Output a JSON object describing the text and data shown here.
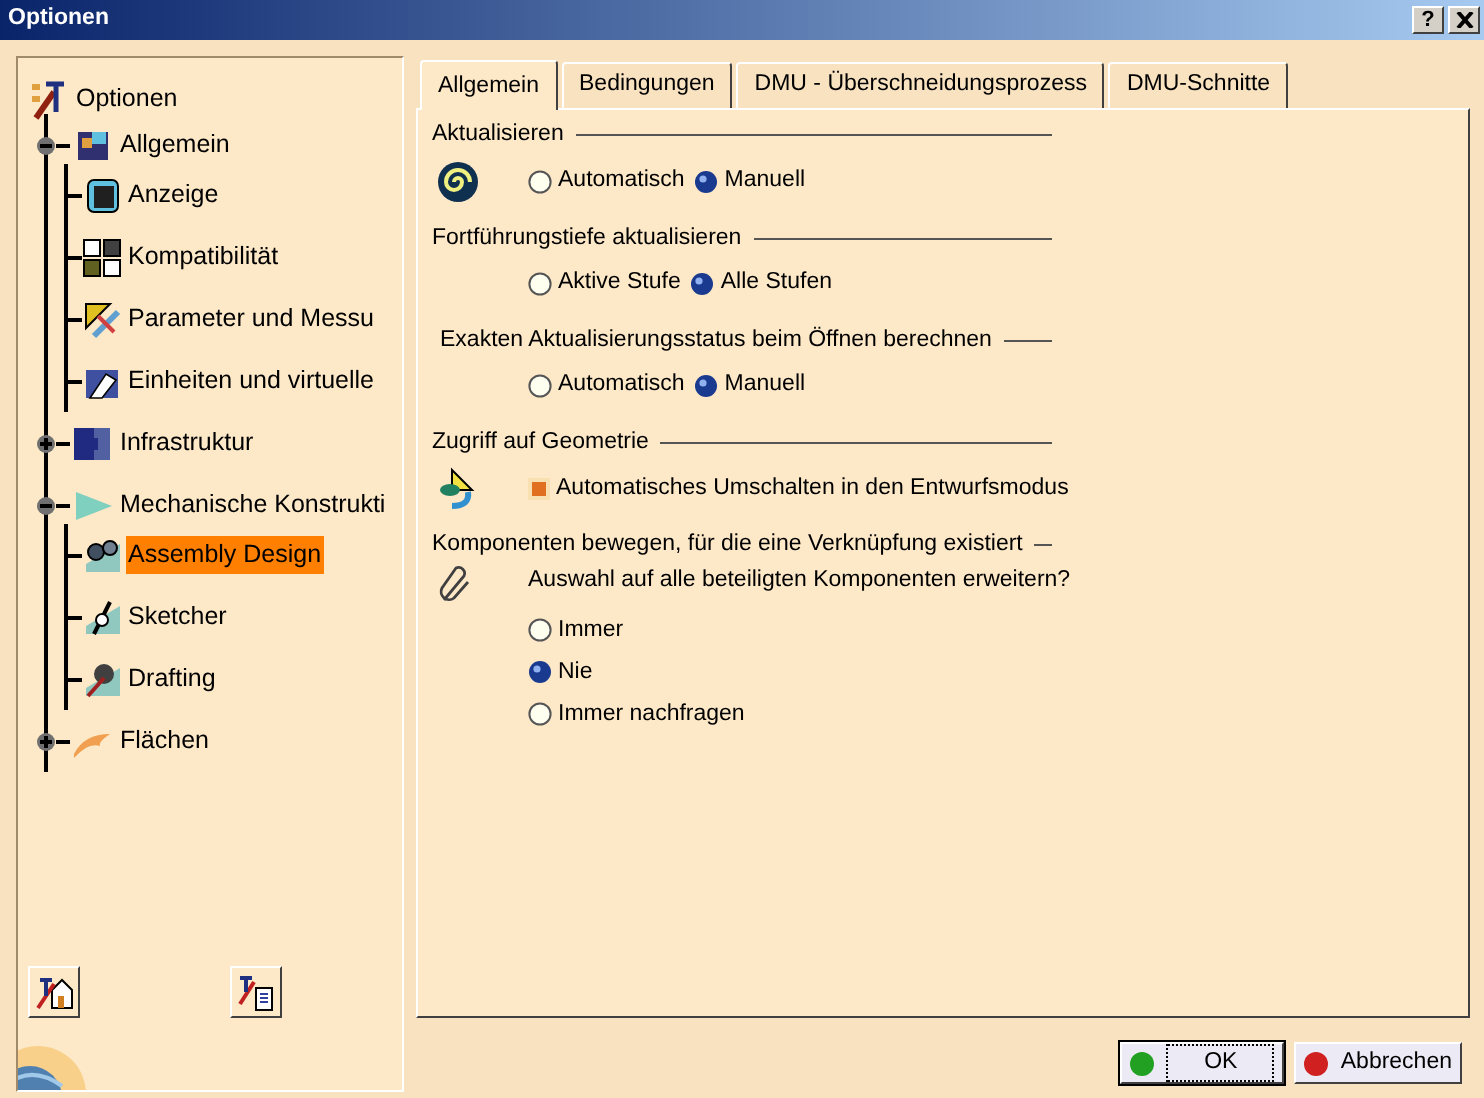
{
  "window": {
    "title": "Optionen",
    "help": "?"
  },
  "tree": {
    "label": "Optionen",
    "selected": false,
    "children": [
      {
        "label": "Allgemein",
        "expanded": true,
        "selected": false,
        "children": [
          {
            "label": "Anzeige",
            "selected": false
          },
          {
            "label": "Kompatibilität",
            "selected": false
          },
          {
            "label": "Parameter und Messu",
            "selected": false
          },
          {
            "label": "Einheiten und virtuelle",
            "selected": false
          }
        ]
      },
      {
        "label": "Infrastruktur",
        "expanded": false,
        "selected": false
      },
      {
        "label": "Mechanische Konstrukti",
        "expanded": true,
        "selected": false,
        "children": [
          {
            "label": "Assembly Design",
            "selected": true
          },
          {
            "label": "Sketcher",
            "selected": false
          },
          {
            "label": "Drafting",
            "selected": false
          }
        ]
      },
      {
        "label": "Flächen",
        "expanded": false,
        "selected": false
      }
    ]
  },
  "tabs": [
    {
      "label": "Allgemein",
      "selected": true
    },
    {
      "label": "Bedingungen",
      "selected": false
    },
    {
      "label": "DMU - Überschneidungsprozess",
      "selected": false
    },
    {
      "label": "DMU-Schnitte",
      "selected": false
    }
  ],
  "sections": [
    {
      "title": "Aktualisieren",
      "kind": "inline",
      "options": [
        {
          "kind": "radio",
          "label": "Automatisch",
          "selected": false
        },
        {
          "kind": "radio",
          "label": "Manuell",
          "selected": true
        }
      ]
    },
    {
      "title": "Fortführungstiefe aktualisieren",
      "kind": "inline",
      "options": [
        {
          "kind": "radio",
          "label": "Aktive Stufe",
          "selected": false
        },
        {
          "kind": "radio",
          "label": "Alle Stufen",
          "selected": true
        }
      ]
    },
    {
      "title": "Exakten Aktualisierungsstatus beim Öffnen berechnen",
      "kind": "inline",
      "options": [
        {
          "kind": "radio",
          "label": "Automatisch",
          "selected": false
        },
        {
          "kind": "radio",
          "label": "Manuell",
          "selected": true
        }
      ]
    },
    {
      "title": "Zugriff auf Geometrie",
      "kind": "inline",
      "options": [
        {
          "kind": "checkbox",
          "label": "Automatisches Umschalten in den Entwurfsmodus",
          "checked": true
        }
      ]
    },
    {
      "title": "Komponenten bewegen, für die eine Verknüpfung existiert",
      "kind": "stacked",
      "question": "Auswahl auf alle beteiligten Komponenten erweitern?",
      "options": [
        {
          "kind": "radio",
          "label": "Immer",
          "selected": false
        },
        {
          "kind": "radio",
          "label": "Nie",
          "selected": true
        },
        {
          "kind": "radio",
          "label": "Immer nachfragen",
          "selected": false
        }
      ]
    }
  ],
  "buttons": [
    {
      "label": "OK",
      "default": true,
      "color": "#22a022"
    },
    {
      "label": "Abbrechen",
      "default": false,
      "color": "#d02020"
    }
  ]
}
